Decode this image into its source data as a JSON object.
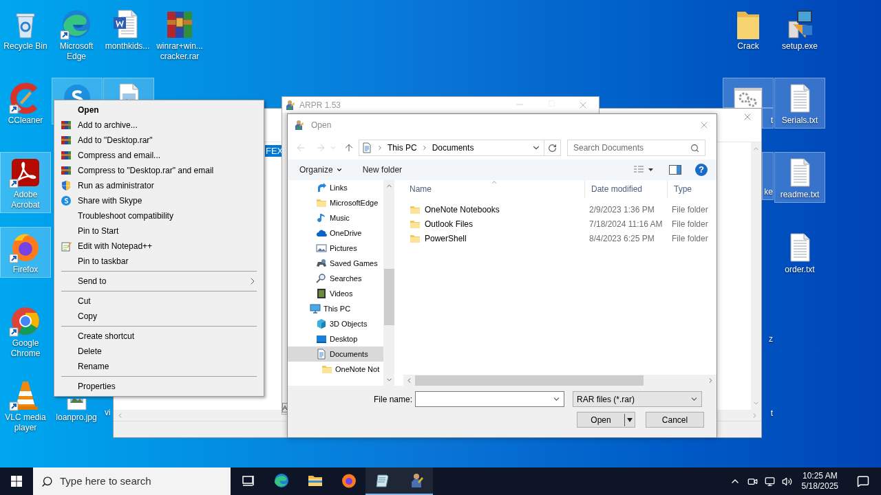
{
  "desktop_icons": [
    {
      "label": "Recycle Bin",
      "kind": "recycle",
      "selected": false,
      "shortcut": false
    },
    {
      "label": "Microsoft Edge",
      "kind": "edge",
      "selected": false,
      "shortcut": true
    },
    {
      "label": "monthkids...",
      "kind": "word",
      "selected": false,
      "shortcut": false
    },
    {
      "label": "winrar+win... cracker.rar",
      "kind": "winrar",
      "selected": false,
      "shortcut": false
    },
    {
      "label": "Crack",
      "kind": "folder",
      "selected": false,
      "shortcut": false
    },
    {
      "label": "setup.exe",
      "kind": "setup",
      "selected": false,
      "shortcut": false
    },
    {
      "label": "CCleaner",
      "kind": "ccleaner",
      "selected": false,
      "shortcut": true
    },
    {
      "kind": "skype",
      "selected": true,
      "shortcut": false
    },
    {
      "kind": "image",
      "selected": true,
      "shortcut": false
    },
    {
      "label": "t",
      "kind": "gear",
      "selected": true,
      "shortcut": false
    },
    {
      "label": "Serials.txt",
      "kind": "text",
      "selected": true,
      "shortcut": false
    },
    {
      "label": "Adobe Acrobat",
      "kind": "acrobat",
      "selected": true,
      "shortcut": true
    },
    {
      "label": "ke",
      "selected": true
    },
    {
      "label": "readme.txt",
      "kind": "text",
      "selected": true,
      "shortcut": false
    },
    {
      "label": "Firefox",
      "kind": "firefox",
      "selected": true,
      "shortcut": true
    },
    {
      "label": "order.txt",
      "kind": "text",
      "selected": false,
      "shortcut": false
    },
    {
      "label": "Google Chrome",
      "kind": "chrome",
      "selected": false,
      "shortcut": true
    },
    {
      "label": "z",
      "selected": false
    },
    {
      "label": "VLC media player",
      "kind": "vlc",
      "selected": false,
      "shortcut": true
    },
    {
      "label": "loanpro.jpg",
      "kind": "image",
      "selected": false,
      "shortcut": false
    },
    {
      "label": "vi",
      "selected": false
    },
    {
      "label": "t",
      "selected": false
    }
  ],
  "background_window": {
    "selected_text": "FEX"
  },
  "arpr_window": {
    "title": "ARPR 1.53",
    "button_text": "A"
  },
  "open_dialog": {
    "title": "Open",
    "path": [
      "This PC",
      "Documents"
    ],
    "search": {
      "placeholder": "Search Documents"
    },
    "toolbar": {
      "organize": "Organize",
      "new_folder": "New folder",
      "help": "?"
    },
    "nav": {
      "pinned_items": [
        {
          "label": "Links",
          "kind": "links",
          "selected": false
        },
        {
          "label": "MicrosoftEdge",
          "kind": "folder",
          "selected": false
        },
        {
          "label": "Music",
          "kind": "music",
          "selected": false
        },
        {
          "label": "OneDrive",
          "kind": "onedrive",
          "selected": false
        },
        {
          "label": "Pictures",
          "kind": "pictures",
          "selected": false
        },
        {
          "label": "Saved Games",
          "kind": "saved-games",
          "selected": false
        },
        {
          "label": "Searches",
          "kind": "searches",
          "selected": false
        },
        {
          "label": "Videos",
          "kind": "videos",
          "selected": false
        }
      ],
      "tree": [
        {
          "label": "This PC",
          "kind": "pc",
          "selected": false,
          "children": [
            {
              "label": "3D Objects",
              "kind": "cube",
              "selected": false
            },
            {
              "label": "Desktop",
              "kind": "desktop",
              "selected": false
            },
            {
              "label": "Documents",
              "kind": "documents",
              "selected": true,
              "children": [
                {
                  "label": "OneNote Not",
                  "kind": "folder",
                  "selected": false
                }
              ]
            }
          ]
        }
      ]
    },
    "columns": [
      "Name",
      "Date modified",
      "Type"
    ],
    "files": [
      {
        "name": "OneNote Notebooks",
        "date": "2/9/2023 1:36 PM",
        "type": "File folder"
      },
      {
        "name": "Outlook Files",
        "date": "7/18/2024 11:16 AM",
        "type": "File folder"
      },
      {
        "name": "PowerShell",
        "date": "8/4/2023 6:25 PM",
        "type": "File folder"
      }
    ],
    "file_name": {
      "label": "File name:"
    },
    "filter": "RAR files (*.rar)",
    "buttons": [
      {
        "label": "Open",
        "kind": "split"
      },
      {
        "label": "Cancel",
        "kind": "plain"
      }
    ]
  },
  "context_menu": [
    {
      "kind": "plain",
      "label": "Open",
      "default": true
    },
    {
      "kind": "winrar",
      "label": "Add to archive..."
    },
    {
      "kind": "winrar",
      "label": "Add to \"Desktop.rar\""
    },
    {
      "kind": "winrar",
      "label": "Compress and email..."
    },
    {
      "kind": "winrar",
      "label": "Compress to \"Desktop.rar\" and email"
    },
    {
      "kind": "shield",
      "label": "Run as administrator"
    },
    {
      "kind": "skype",
      "label": "Share with Skype"
    },
    {
      "kind": "plain",
      "label": "Troubleshoot compatibility"
    },
    {
      "kind": "plain",
      "label": "Pin to Start"
    },
    {
      "kind": "notepad",
      "label": "Edit with Notepad++"
    },
    {
      "kind": "plain",
      "label": "Pin to taskbar"
    },
    {
      "kind": "separator"
    },
    {
      "kind": "plain",
      "label": "Send to",
      "submenu": true
    },
    {
      "kind": "separator"
    },
    {
      "kind": "plain",
      "label": "Cut"
    },
    {
      "kind": "plain",
      "label": "Copy"
    },
    {
      "kind": "separator"
    },
    {
      "kind": "plain",
      "label": "Create shortcut"
    },
    {
      "kind": "plain",
      "label": "Delete"
    },
    {
      "kind": "plain",
      "label": "Rename"
    },
    {
      "kind": "separator"
    },
    {
      "kind": "plain",
      "label": "Properties"
    }
  ],
  "taskbar": {
    "search": {
      "placeholder": "Type here to search"
    },
    "apps": [
      {
        "kind": "taskview",
        "running": false
      },
      {
        "kind": "edge",
        "running": false
      },
      {
        "kind": "explorer",
        "running": false
      },
      {
        "kind": "firefox",
        "running": false
      },
      {
        "kind": "notepad",
        "running": true
      },
      {
        "kind": "arpr",
        "running": true
      }
    ],
    "time": "10:25 AM",
    "date": "5/18/2025"
  }
}
